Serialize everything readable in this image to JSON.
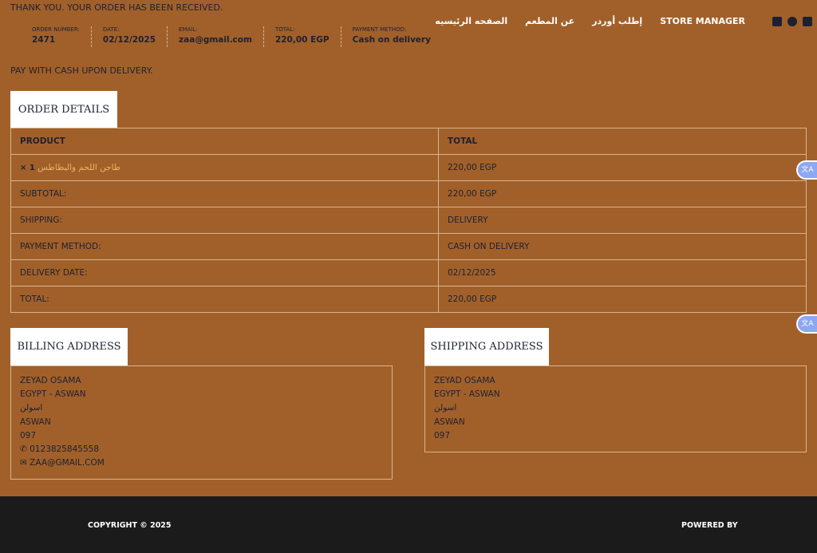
{
  "header": {
    "thank_you": "THANK YOU. YOUR ORDER HAS BEEN RECEIVED.",
    "pay_note": "PAY WITH CASH UPON DELIVERY.",
    "overview": [
      {
        "label": "ORDER NUMBER:",
        "value": "2471"
      },
      {
        "label": "DATE:",
        "value": "02/12/2025"
      },
      {
        "label": "EMAIL:",
        "value": "zaa@gmail.com"
      },
      {
        "label": "TOTAL:",
        "value": "220,00 EGP"
      },
      {
        "label": "PAYMENT METHOD:",
        "value": "Cash on delivery"
      }
    ]
  },
  "nav": {
    "items": [
      "الصفحه الرئيسيه",
      "عن المطعم",
      "إطلب أوردر",
      "STORE MANAGER"
    ],
    "social": [
      "facebook-icon",
      "twitter-icon",
      "instagram-icon"
    ]
  },
  "order": {
    "title": "ORDER DETAILS",
    "headers": [
      "PRODUCT",
      "TOTAL"
    ],
    "product": {
      "name": "طاجن اللحم والبطاطس",
      "qty": "× 1",
      "total": "220,00 EGP"
    },
    "rows": [
      {
        "label": "SUBTOTAL:",
        "value": "220,00 EGP"
      },
      {
        "label": "SHIPPING:",
        "value": "DELIVERY"
      },
      {
        "label": "PAYMENT METHOD:",
        "value": "CASH ON DELIVERY"
      },
      {
        "label": "DELIVERY DATE:",
        "value": "02/12/2025"
      },
      {
        "label": "TOTAL:",
        "value": "220,00 EGP"
      }
    ]
  },
  "billing": {
    "title": "BILLING ADDRESS",
    "lines": [
      "ZEYAD OSAMA",
      "EGYPT - ASWAN",
      "اسولن",
      "ASWAN",
      "097"
    ],
    "phone": "0123825845558",
    "email": "ZAA@GMAIL.COM"
  },
  "shipping": {
    "title": "SHIPPING ADDRESS",
    "lines": [
      "ZEYAD OSAMA",
      "EGYPT - ASWAN",
      "اسولن",
      "ASWAN",
      "097"
    ]
  },
  "footer": {
    "copyright": "COPYRIGHT © 2025",
    "powered": "POWERED BY"
  },
  "colors": {
    "bg": "#a1602a",
    "footer": "#1b1b1b",
    "link": "#e8b660"
  }
}
